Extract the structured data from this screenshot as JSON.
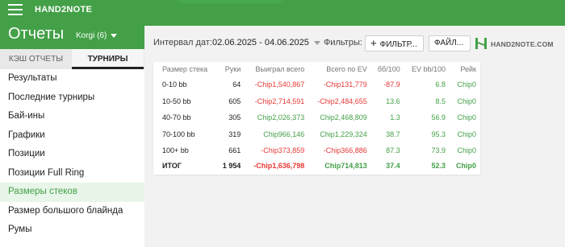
{
  "app": {
    "brand": "HAND2NOTE"
  },
  "sidebar": {
    "title": "Отчеты",
    "user": "Korgi (6)",
    "tabs": [
      {
        "label": "КЭШ ОТЧЕТЫ"
      },
      {
        "label": "ТУРНИРЫ",
        "active": true
      }
    ],
    "items": [
      {
        "label": "Результаты"
      },
      {
        "label": "Последние турниры"
      },
      {
        "label": "Бай-ины"
      },
      {
        "label": "Графики"
      },
      {
        "label": "Позиции"
      },
      {
        "label": "Позиции Full Ring"
      },
      {
        "label": "Размеры стеков",
        "active": true
      },
      {
        "label": "Размер большого блайнда"
      },
      {
        "label": "Румы"
      }
    ]
  },
  "filters": {
    "interval_label": "Интервал дат:",
    "date_range": "02.06.2025 - 04.06.2025",
    "filters_label": "Фильтры:",
    "filter_button": "ФИЛЬТР...",
    "file_button": "ФАЙЛ...",
    "logo_text": "HAND2NOTE.COM"
  },
  "table": {
    "headers": [
      "Размер стека",
      "Руки",
      "Выиграл всего",
      "Всего по EV",
      "бб/100",
      "EV bb/100",
      "Рейк"
    ],
    "rows": [
      {
        "cells": [
          "0-10 bb",
          "64",
          "-Chip1,540,867",
          "-Chip131,779",
          "-87.9",
          "6.8",
          "Chip0"
        ],
        "signs": [
          "",
          "",
          "neg",
          "neg",
          "neg",
          "pos",
          "pos"
        ]
      },
      {
        "cells": [
          "10-50 bb",
          "605",
          "-Chip2,714,591",
          "-Chip2,484,655",
          "13.6",
          "8.5",
          "Chip0"
        ],
        "signs": [
          "",
          "",
          "neg",
          "neg",
          "pos",
          "pos",
          "pos"
        ]
      },
      {
        "cells": [
          "40-70 bb",
          "305",
          "Chip2,026,373",
          "Chip2,468,809",
          "1.3",
          "56.9",
          "Chip0"
        ],
        "signs": [
          "",
          "",
          "pos",
          "pos",
          "pos",
          "pos",
          "pos"
        ]
      },
      {
        "cells": [
          "70-100 bb",
          "319",
          "Chip966,146",
          "Chip1,229,324",
          "38.7",
          "95.3",
          "Chip0"
        ],
        "signs": [
          "",
          "",
          "pos",
          "pos",
          "pos",
          "pos",
          "pos"
        ]
      },
      {
        "cells": [
          "100+ bb",
          "661",
          "-Chip373,859",
          "-Chip366,886",
          "87.3",
          "73.9",
          "Chip0"
        ],
        "signs": [
          "",
          "",
          "neg",
          "neg",
          "pos",
          "pos",
          "pos"
        ]
      }
    ],
    "total": {
      "cells": [
        "ИТОГ",
        "1 954",
        "-Chip1,636,798",
        "Chip714,813",
        "37.4",
        "52.3",
        "Chip0"
      ],
      "signs": [
        "",
        "",
        "neg",
        "pos",
        "pos",
        "pos",
        "pos"
      ]
    }
  },
  "colors": {
    "brand_green": "#43a047",
    "negative": "#e53935",
    "positive": "#43a047"
  },
  "icons": [
    "hamburger-menu-icon",
    "dropdown-caret-icon",
    "plus-icon",
    "hand2note-logo-icon"
  ]
}
